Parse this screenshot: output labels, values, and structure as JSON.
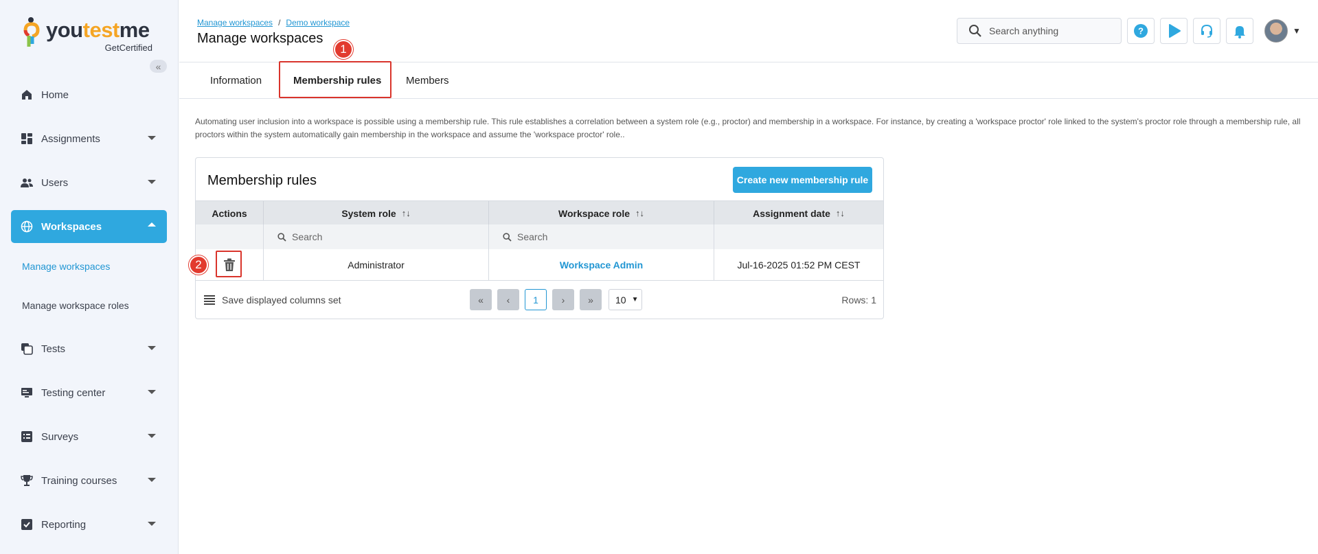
{
  "brand": {
    "name_part1": "you",
    "name_part2": "test",
    "name_part3": "me",
    "tagline": "GetCertified",
    "colors": {
      "accent": "#2fa8df",
      "marker": "#e23a2e",
      "highlight": "#d9342b"
    }
  },
  "sidebar": {
    "collapse_icon": "double-chevron-left-icon",
    "items": [
      {
        "label": "Home",
        "icon": "home-icon"
      },
      {
        "label": "Assignments",
        "icon": "dashboard-icon"
      },
      {
        "label": "Users",
        "icon": "users-icon"
      },
      {
        "label": "Workspaces",
        "icon": "globe-icon"
      },
      {
        "label": "Tests",
        "icon": "tests-icon"
      },
      {
        "label": "Testing center",
        "icon": "monitor-icon"
      },
      {
        "label": "Surveys",
        "icon": "list-icon"
      },
      {
        "label": "Training courses",
        "icon": "trophy-icon"
      },
      {
        "label": "Reporting",
        "icon": "report-icon"
      }
    ],
    "sub_items": [
      {
        "label": "Manage workspaces"
      },
      {
        "label": "Manage workspace roles"
      }
    ]
  },
  "header": {
    "breadcrumb": [
      "Manage workspaces",
      "Demo workspace"
    ],
    "breadcrumb_sep": "/",
    "title": "Manage workspaces",
    "search_placeholder": "Search anything"
  },
  "tabs": [
    {
      "label": "Information"
    },
    {
      "label": "Membership rules"
    },
    {
      "label": "Members"
    }
  ],
  "markers": [
    "1",
    "2"
  ],
  "description": "Automating user inclusion into a workspace is possible using a membership rule. This rule establishes a correlation between a system role (e.g., proctor) and membership in a workspace. For instance, by creating a 'workspace proctor' role linked to the system's proctor role through a membership rule, all proctors within the system automatically gain membership in the workspace and assume the 'workspace proctor' role..",
  "card": {
    "title": "Membership rules",
    "create_button": "Create new membership rule",
    "columns": [
      "Actions",
      "System role",
      "Workspace role",
      "Assignment date"
    ],
    "sort_glyph": "↑↓",
    "filter_placeholder": "Search",
    "rows": [
      {
        "system_role": "Administrator",
        "workspace_role": "Workspace Admin",
        "assignment_date": "Jul-16-2025 01:52 PM CEST"
      }
    ],
    "footer": {
      "save_columns": "Save displayed columns set",
      "current_page": "1",
      "page_size": "10",
      "rows_label": "Rows: 1"
    }
  }
}
